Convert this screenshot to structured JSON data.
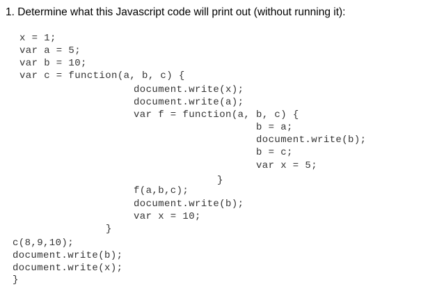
{
  "question": {
    "number": "1.",
    "text": "Determine what this Javascript code will print out (without running it):"
  },
  "code_lines": [
    "x = 1;",
    "var a = 5;",
    "var b = 10;",
    "var c = function(a, b, c) {",
    "document.write(x);",
    "document.write(a);",
    "var f = function(a, b, c) {",
    "b = a;",
    "document.write(b);",
    "b = c;",
    "var x = 5;",
    "}",
    "f(a,b,c);",
    "document.write(b);",
    "var x = 10;",
    "}",
    "c(8,9,10);",
    "document.write(b);",
    "document.write(x);",
    "}"
  ]
}
